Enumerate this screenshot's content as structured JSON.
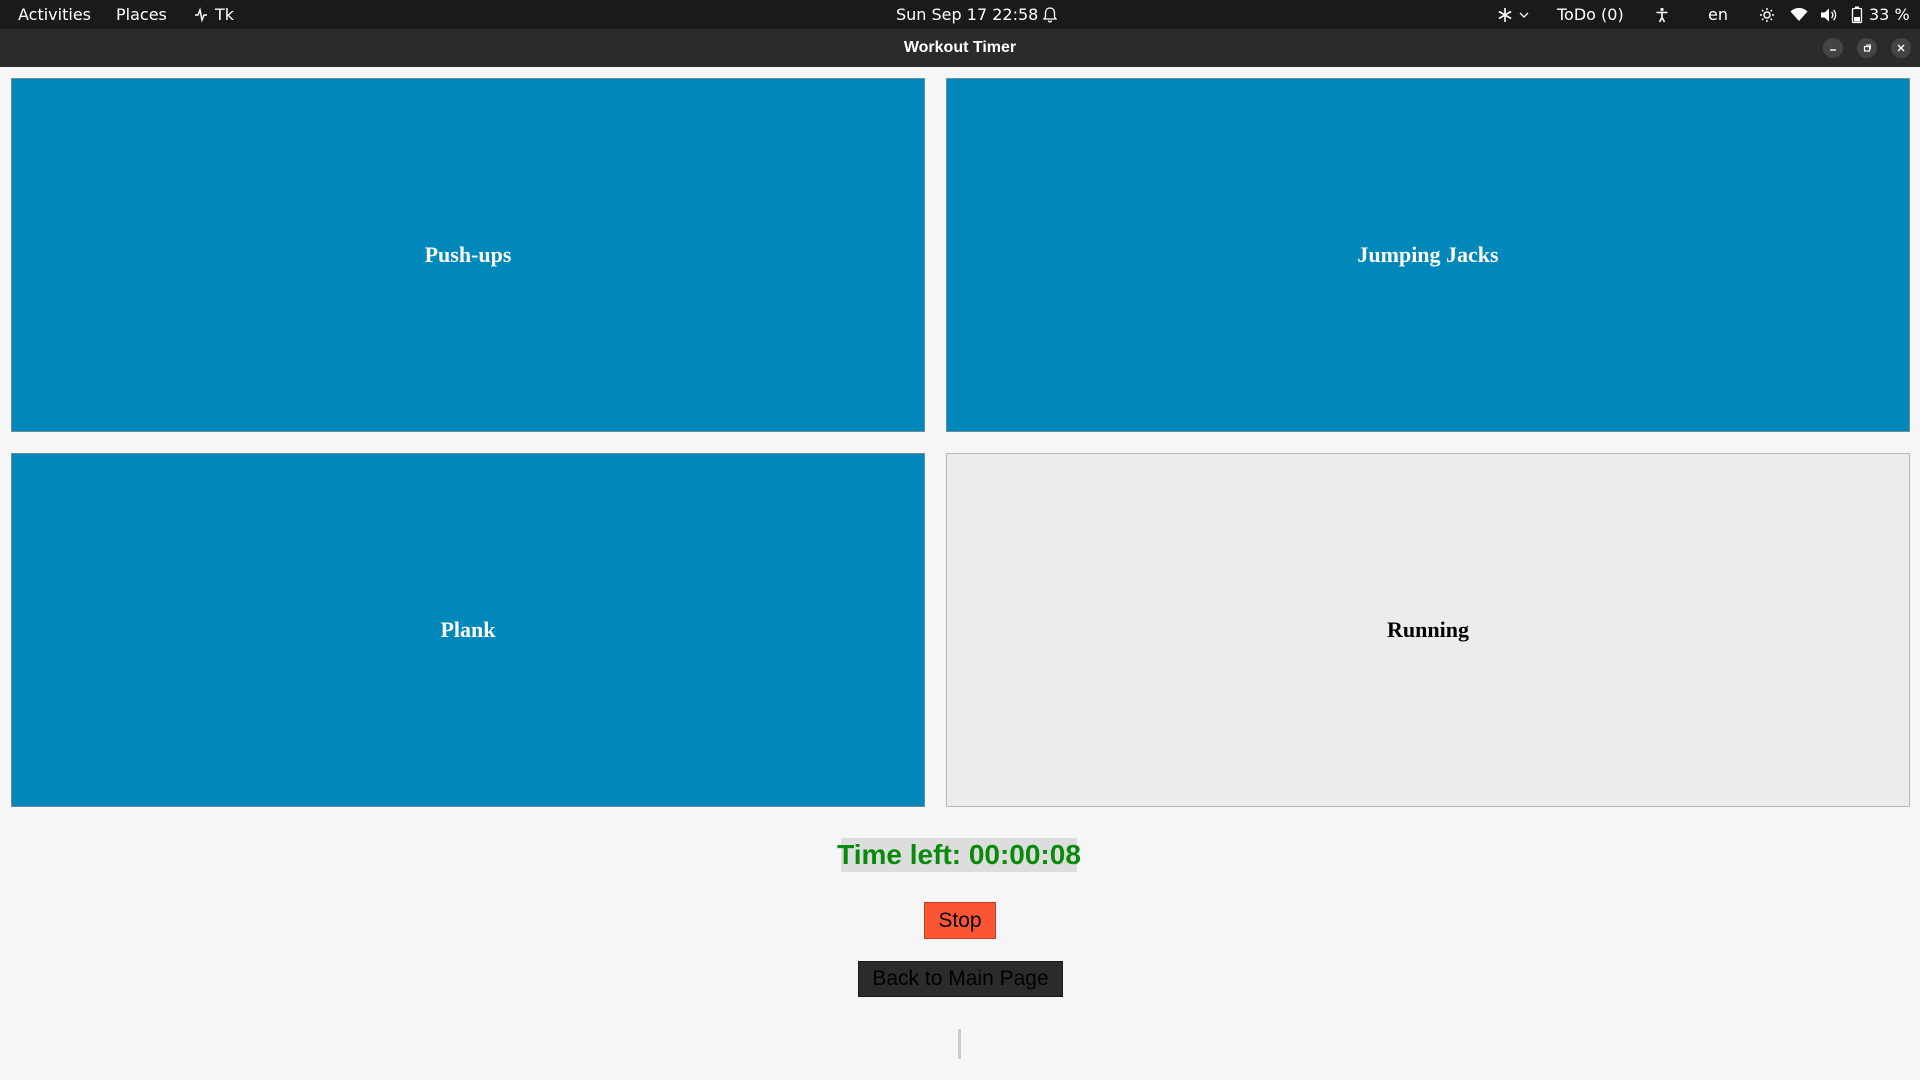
{
  "topbar": {
    "activities": "Activities",
    "places": "Places",
    "app_name": "Tk",
    "datetime": "Sun Sep 17  22:58",
    "todo": "ToDo (0)",
    "language": "en",
    "battery": "33 %"
  },
  "window": {
    "title": "Workout Timer"
  },
  "exercises": [
    {
      "label": "Push-ups",
      "state": "active"
    },
    {
      "label": "Jumping Jacks",
      "state": "active"
    },
    {
      "label": "Plank",
      "state": "active"
    },
    {
      "label": "Running",
      "state": "inactive"
    }
  ],
  "timer": {
    "text": "Time left: 00:00:08"
  },
  "buttons": {
    "stop": "Stop",
    "back": "Back to Main Page"
  },
  "colors": {
    "exercise_active": "#0088bb",
    "exercise_inactive": "#ececec",
    "timer_text": "#0a8a0a",
    "stop_button": "#fb5533",
    "back_button": "#2b2b2b"
  },
  "icons": [
    "show-apps-icon",
    "bell-icon",
    "snowflake-icon",
    "chevron-down-icon",
    "accessibility-icon",
    "brightness-icon",
    "wifi-icon",
    "volume-icon",
    "battery-icon",
    "minimize-icon",
    "maximize-icon",
    "close-icon"
  ]
}
